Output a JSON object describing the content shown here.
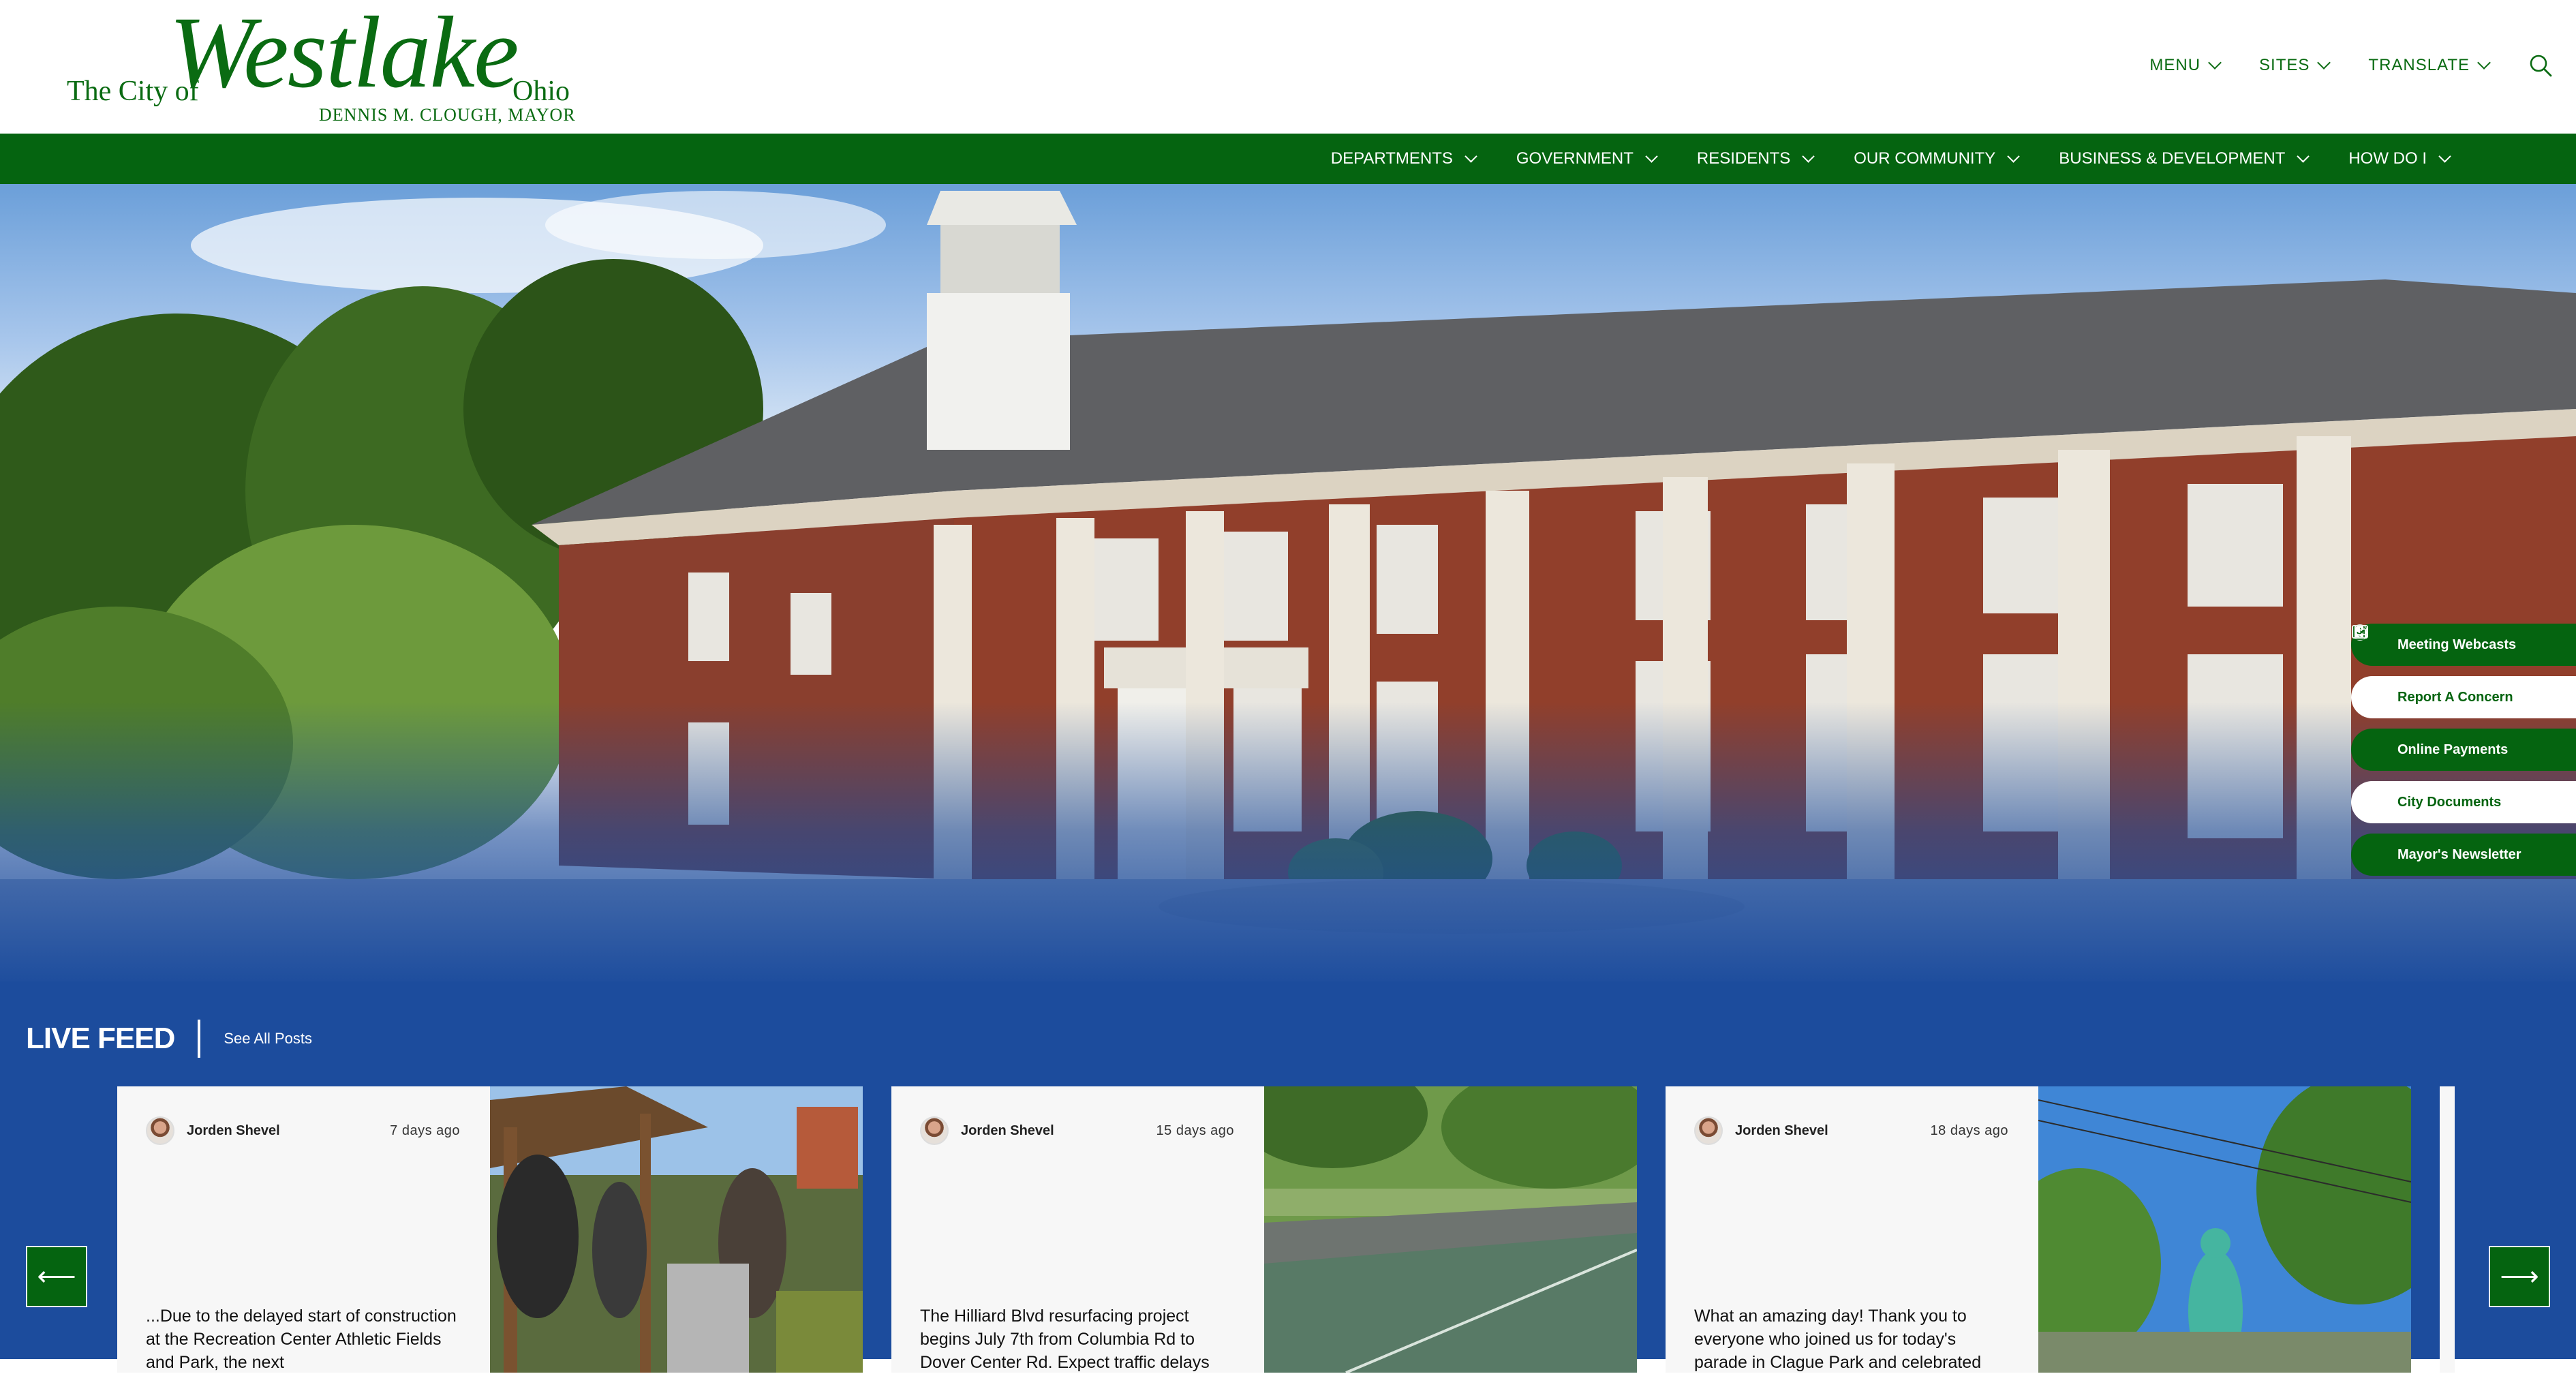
{
  "logo": {
    "prefix": "The City of",
    "name": "Westlake",
    "suffix": "Ohio",
    "mayor": "DENNIS M. CLOUGH, MAYOR"
  },
  "utility": {
    "menu": "MENU",
    "sites": "SITES",
    "translate": "TRANSLATE"
  },
  "nav": [
    {
      "label": "DEPARTMENTS"
    },
    {
      "label": "GOVERNMENT"
    },
    {
      "label": "RESIDENTS"
    },
    {
      "label": "OUR COMMUNITY"
    },
    {
      "label": "BUSINESS & DEVELOPMENT"
    },
    {
      "label": "HOW DO I"
    }
  ],
  "quick_links": [
    {
      "label": "Meeting Webcasts",
      "icon": "camera-icon"
    },
    {
      "label": "Report A Concern",
      "icon": "info-icon"
    },
    {
      "label": "Online Payments",
      "icon": "dollar-icon"
    },
    {
      "label": "City Documents",
      "icon": "document-edit-icon"
    },
    {
      "label": "Mayor's Newsletter",
      "icon": "newsletter-icon"
    }
  ],
  "feed": {
    "title": "LIVE FEED",
    "see_all": "See All Posts",
    "posts": [
      {
        "author": "Jorden Shevel",
        "ago": "7 days ago",
        "text": "...Due to the delayed start of construction at the Recreation Center Athletic Fields and Park, the next"
      },
      {
        "author": "Jorden Shevel",
        "ago": "15 days ago",
        "text": "The Hilliard Blvd resurfacing project begins July 7th from Columbia Rd to Dover Center Rd. Expect traffic delays"
      },
      {
        "author": "Jorden Shevel",
        "ago": "18 days ago",
        "text": "What an amazing day! Thank you to everyone who joined us for today's parade in Clague Park and celebrated"
      }
    ],
    "prev_label": "⟵",
    "next_label": "⟶"
  },
  "colors": {
    "brand_green": "#056410",
    "feed_blue": "#1c4c9d",
    "card_bg": "#f7f7f7"
  }
}
